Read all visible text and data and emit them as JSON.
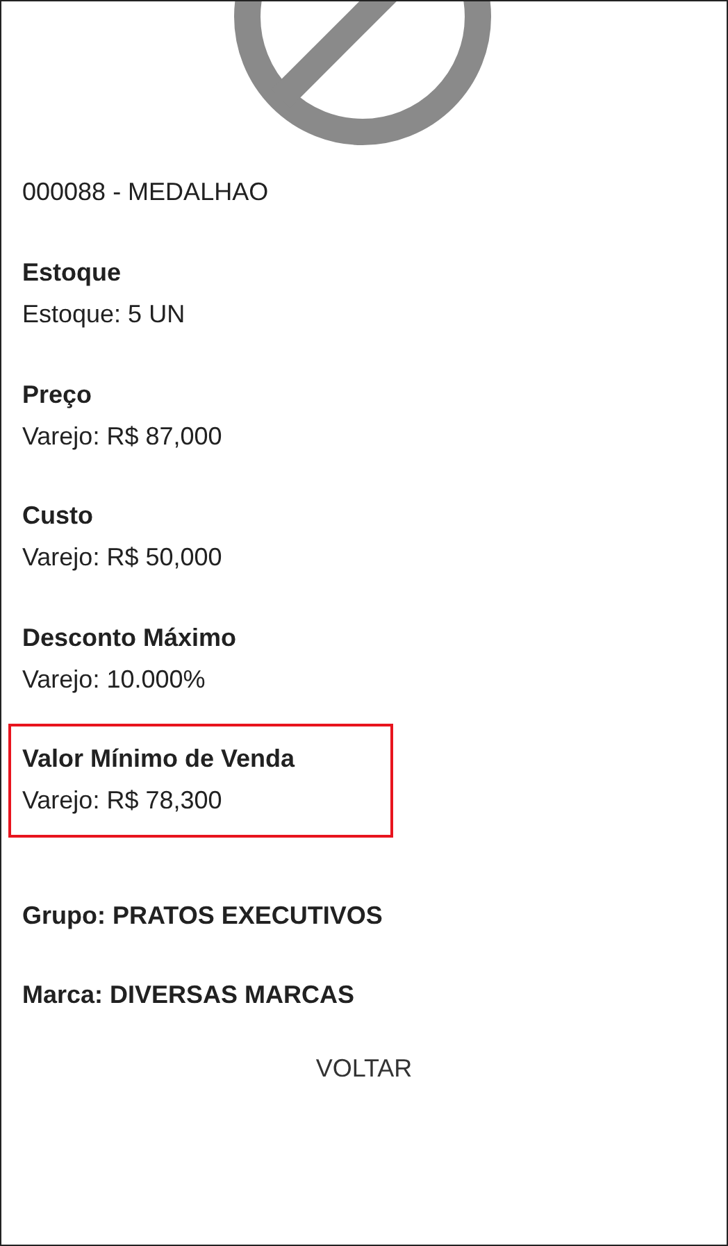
{
  "product_title": "000088 - MEDALHAO",
  "sections": [
    {
      "heading": "Estoque",
      "value": "Estoque: 5 UN",
      "highlighted": false
    },
    {
      "heading": "Preço",
      "value": "Varejo: R$ 87,000",
      "highlighted": false
    },
    {
      "heading": "Custo",
      "value": "Varejo: R$ 50,000",
      "highlighted": false
    },
    {
      "heading": "Desconto Máximo",
      "value": "Varejo: 10.000%",
      "highlighted": false
    },
    {
      "heading": "Valor Mínimo de Venda",
      "value": "Varejo: R$ 78,300",
      "highlighted": true
    }
  ],
  "group": "Grupo: PRATOS EXECUTIVOS",
  "brand": "Marca: DIVERSAS MARCAS",
  "back_button": "VOLTAR"
}
